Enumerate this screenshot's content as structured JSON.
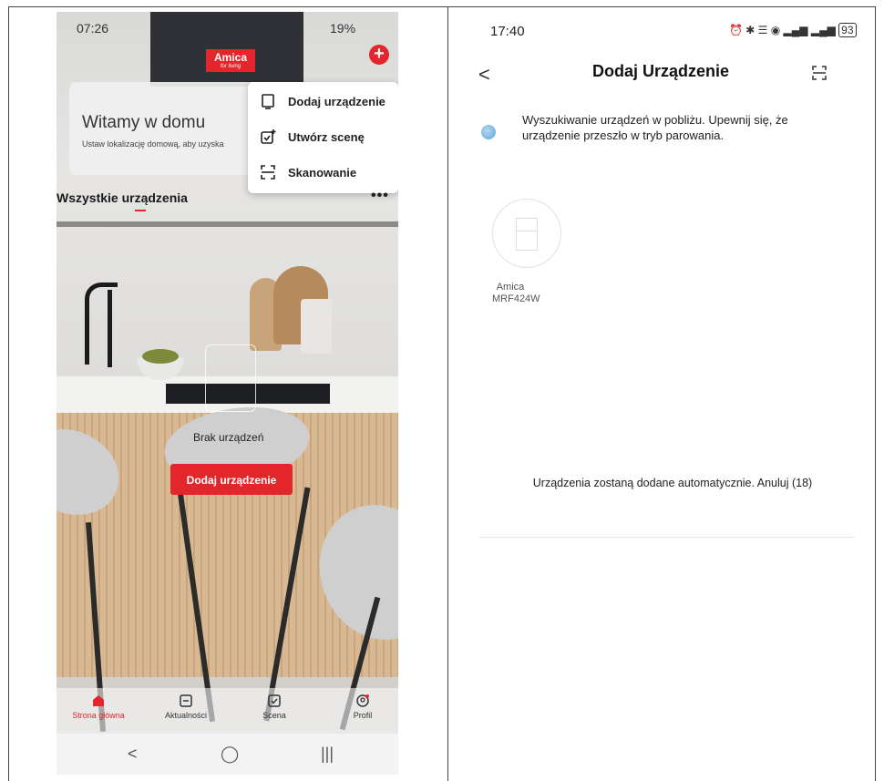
{
  "left_phone": {
    "status_time": "07:26",
    "status_right": "19%",
    "brand": {
      "name": "Amica",
      "tagline": "for living"
    },
    "welcome": {
      "title": "Witamy w domu",
      "subtitle": "Ustaw lokalizację domową, aby uzyska"
    },
    "popup_menu": [
      {
        "label": "Dodaj urządzenie",
        "icon": "device-add-icon"
      },
      {
        "label": "Utwórz scenę",
        "icon": "scene-create-icon"
      },
      {
        "label": "Skanowanie",
        "icon": "scan-icon"
      }
    ],
    "section_title": "Wszystkie urządzenia",
    "empty_text": "Brak urządzeń",
    "add_button": "Dodaj urządzenie",
    "bottom_nav": [
      {
        "label": "Strona główna",
        "icon": "home-icon",
        "active": true
      },
      {
        "label": "Aktualności",
        "icon": "news-icon",
        "active": false
      },
      {
        "label": "Scena",
        "icon": "scene-icon",
        "active": false
      },
      {
        "label": "Profil",
        "icon": "profile-icon",
        "active": false
      }
    ],
    "system_nav": [
      "<",
      "◯",
      "|||"
    ]
  },
  "right_phone": {
    "status_time": "17:40",
    "status_right": "93",
    "title": "Dodaj Urządzenie",
    "search_text": "Wyszukiwanie urządzeń w pobliżu. Upewnij się, że urządzenie przeszło w tryb parowania.",
    "device": {
      "brand": "Amica",
      "model": "MRF424W"
    },
    "footer_text": "Urządzenia zostaną dodane automatycznie. Anuluj (18)"
  },
  "colors": {
    "accent": "#e3262c",
    "text": "#222222"
  }
}
